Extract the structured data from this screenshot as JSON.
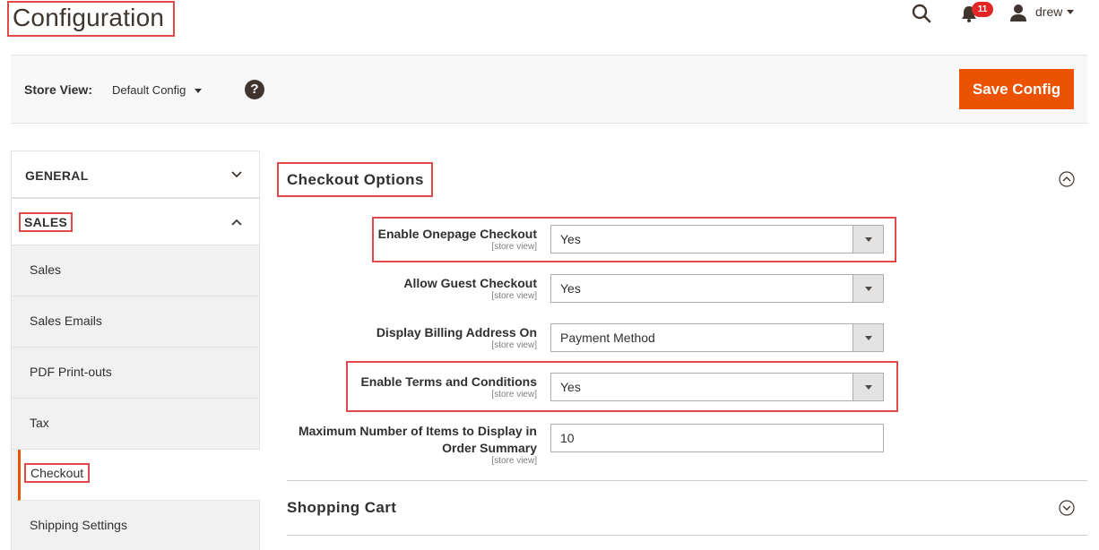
{
  "header": {
    "page_title": "Configuration",
    "notification_count": "11",
    "user_name": "drew"
  },
  "store_bar": {
    "label": "Store View:",
    "selected": "Default Config",
    "help": "?",
    "save_label": "Save Config"
  },
  "sidebar": {
    "groups": [
      {
        "label": "GENERAL",
        "expanded": false
      },
      {
        "label": "SALES",
        "expanded": true
      }
    ],
    "items": [
      {
        "label": "Sales"
      },
      {
        "label": "Sales Emails"
      },
      {
        "label": "PDF Print-outs"
      },
      {
        "label": "Tax"
      },
      {
        "label": "Checkout",
        "active": true
      },
      {
        "label": "Shipping Settings"
      }
    ]
  },
  "main": {
    "section_title": "Checkout Options",
    "fields": [
      {
        "label": "Enable Onepage Checkout",
        "scope": "[store view]",
        "value": "Yes"
      },
      {
        "label": "Allow Guest Checkout",
        "scope": "[store view]",
        "value": "Yes"
      },
      {
        "label": "Display Billing Address On",
        "scope": "[store view]",
        "value": "Payment Method"
      },
      {
        "label": "Enable Terms and Conditions",
        "scope": "[store view]",
        "value": "Yes"
      },
      {
        "label_line1": "Maximum Number of Items to Display in",
        "label_line2": "Order Summary",
        "scope": "[store view]",
        "value": "10"
      }
    ],
    "next_section_title": "Shopping Cart"
  },
  "colors": {
    "accent": "#eb5202",
    "highlight": "#e04a4a",
    "badge": "#e22626"
  }
}
